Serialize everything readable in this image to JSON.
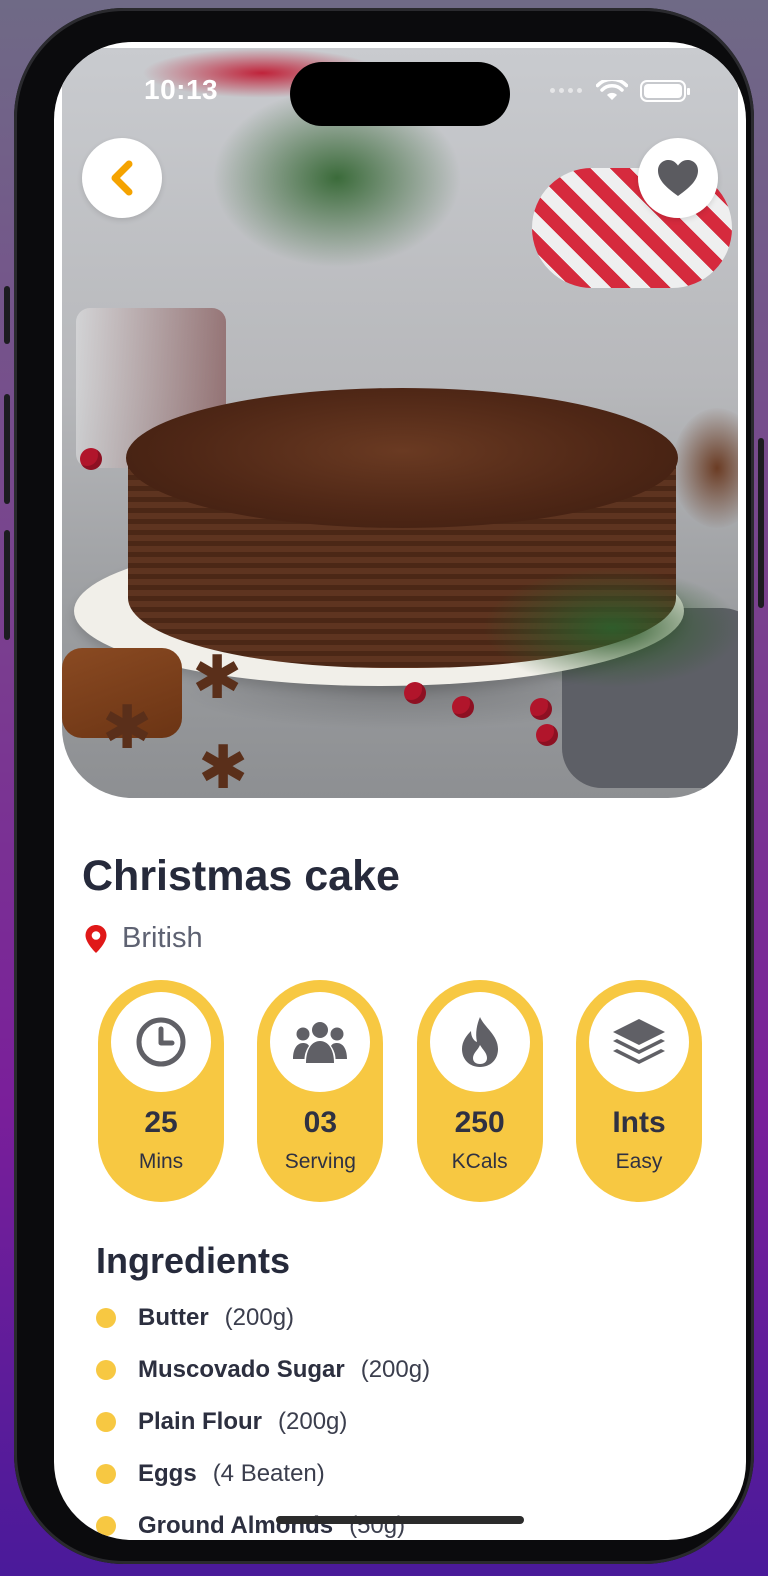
{
  "status_bar": {
    "time": "10:13"
  },
  "recipe": {
    "title": "Christmas cake",
    "origin": "British"
  },
  "stats": [
    {
      "icon": "clock-icon",
      "value": "25",
      "unit": "Mins"
    },
    {
      "icon": "people-icon",
      "value": "03",
      "unit": "Serving"
    },
    {
      "icon": "flame-icon",
      "value": "250",
      "unit": "KCals"
    },
    {
      "icon": "layers-icon",
      "value": "Ints",
      "unit": "Easy"
    }
  ],
  "ingredients": {
    "title": "Ingredients",
    "items": [
      {
        "name": "Butter",
        "qty": "(200g)"
      },
      {
        "name": "Muscovado Sugar",
        "qty": "(200g)"
      },
      {
        "name": "Plain Flour",
        "qty": "(200g)"
      },
      {
        "name": "Eggs",
        "qty": "(4 Beaten)"
      },
      {
        "name": "Ground Almonds",
        "qty": "(50g)"
      }
    ]
  },
  "colors": {
    "accent": "#f7c842",
    "back_arrow": "#f5a300",
    "title": "#262a3b",
    "pin": "#e01818"
  }
}
